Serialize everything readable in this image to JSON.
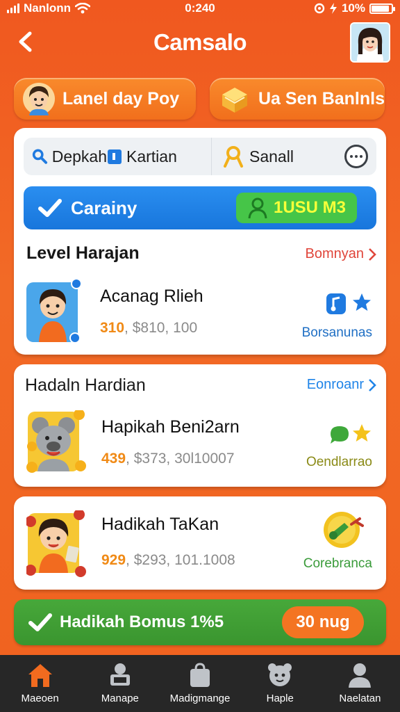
{
  "status_bar": {
    "carrier": "Nanlonn",
    "time": "0:240",
    "battery": "10%",
    "battery_level": 0.9
  },
  "header": {
    "title": "Camsalo"
  },
  "top_pills": {
    "left_label": "Lanel day Poy",
    "right_label": "Ua Sen Banlnls"
  },
  "tabs": {
    "tab_a": "Depkah",
    "tab_b": "Kartian",
    "tab_c": "Sanall"
  },
  "blue_banner": {
    "label": "Carainy",
    "chip_label": "1USU M3"
  },
  "section_1": {
    "title": "Level Harajan",
    "link": "Bomnyan",
    "item": {
      "title": "Acanag Rlieh",
      "meta_highlight": "310",
      "meta_rest": ", $810, 100",
      "tag": "Borsanunas"
    }
  },
  "section_2": {
    "title": "Hadaln Hardian",
    "link": "Eonroanr",
    "item": {
      "title": "Hapikah Beni2arn",
      "meta_highlight": "439",
      "meta_rest": ", $373, 30l10007",
      "tag": "Oendlarrao"
    }
  },
  "section_3": {
    "item": {
      "title": "Hadikah TaKan",
      "meta_highlight": "929",
      "meta_rest": ", $293, 101.1008",
      "tag": "Corebranca"
    }
  },
  "bonus_bar": {
    "label": "Hadikah Bomus 1%5",
    "button": "30 nug"
  },
  "bottom_nav": [
    {
      "label": "Maeoen",
      "icon": "home-icon"
    },
    {
      "label": "Manape",
      "icon": "monitor-icon"
    },
    {
      "label": "Madigmange",
      "icon": "bag-icon"
    },
    {
      "label": "Haple",
      "icon": "pet-icon"
    },
    {
      "label": "Naelatan",
      "icon": "user-icon"
    }
  ],
  "colors": {
    "primary": "#f0581f",
    "blue": "#1f84e8",
    "green": "#46a83a",
    "nav_bg": "#272727"
  }
}
